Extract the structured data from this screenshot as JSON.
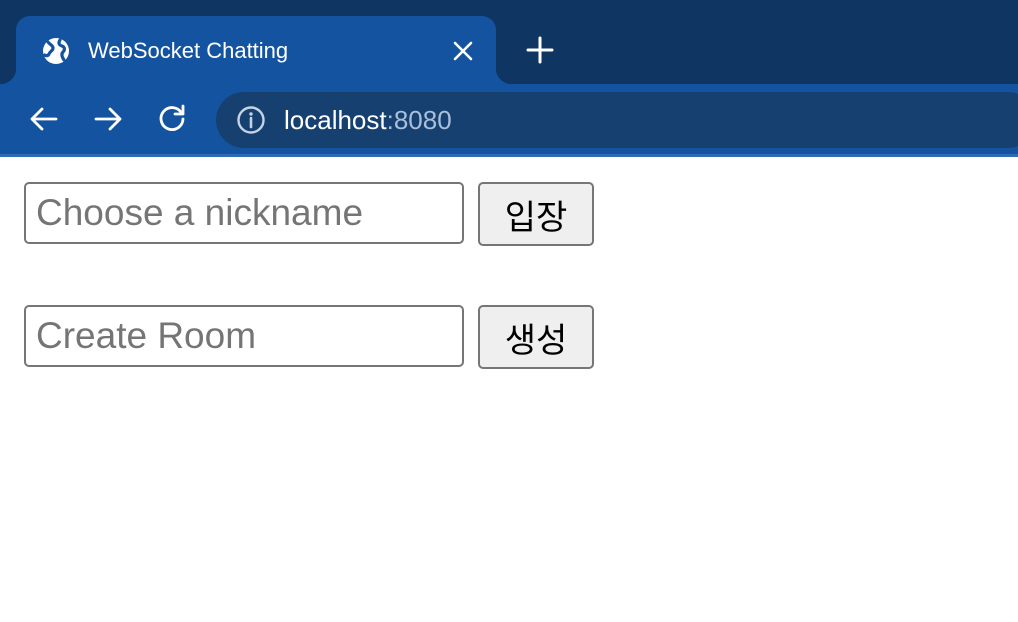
{
  "browser": {
    "tab": {
      "title": "WebSocket Chatting",
      "favicon": "globe-icon"
    },
    "address_bar": {
      "host": "localhost",
      "port": ":8080"
    },
    "colors": {
      "tab_strip": "#0f3563",
      "active_tab": "#1453a0",
      "toolbar": "#1453a0",
      "omnibox": "#16406f"
    }
  },
  "page": {
    "nickname": {
      "value": "",
      "placeholder": "Choose a nickname",
      "button_label": "입장"
    },
    "room": {
      "value": "",
      "placeholder": "Create Room",
      "button_label": "생성"
    }
  }
}
